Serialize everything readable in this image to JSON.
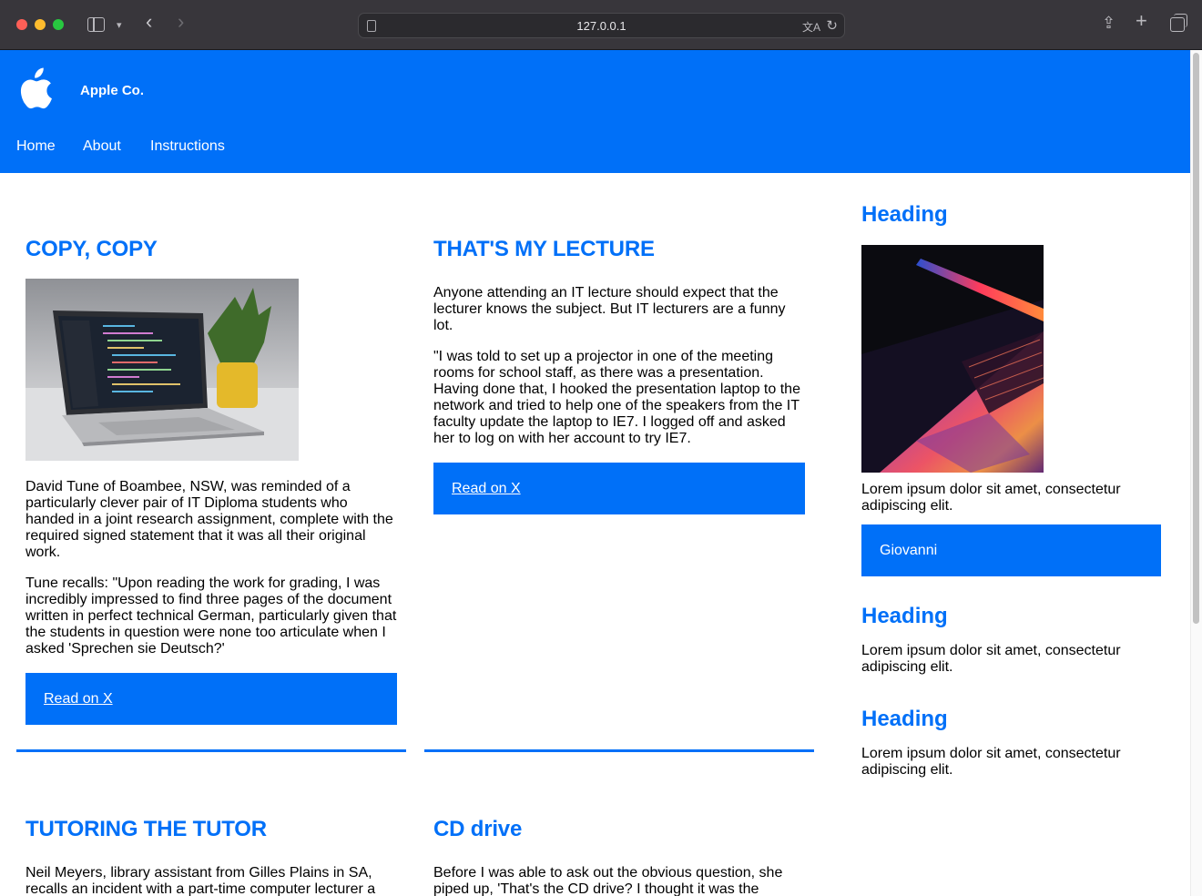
{
  "browser": {
    "url": "127.0.0.1"
  },
  "site": {
    "brand": "Apple Co.",
    "nav": [
      {
        "label": "Home"
      },
      {
        "label": "About"
      },
      {
        "label": "Instructions"
      }
    ]
  },
  "articles": [
    {
      "title": "COPY, COPY",
      "paragraphs": [
        "David Tune of Boambee, NSW, was reminded of a particularly clever pair of IT Diploma students who handed in a joint research assignment, complete with the required signed statement that it was all their original work.",
        "Tune recalls: \"Upon reading the work for grading, I was incredibly impressed to find three pages of the document written in perfect technical German, particularly given that the students in question were none too articulate when I asked 'Sprechen sie Deutsch?'"
      ],
      "link": "Read on X"
    },
    {
      "title": "THAT'S MY LECTURE",
      "paragraphs": [
        "Anyone attending an IT lecture should expect that the lecturer knows the subject. But IT lecturers are a funny lot.",
        "\"I was told to set up a projector in one of the meeting rooms for school staff, as there was a presentation. Having done that, I hooked the presentation laptop to the network and tried to help one of the speakers from the IT faculty update the laptop to IE7. I logged off and asked her to log on with her account to try IE7."
      ],
      "link": "Read on X"
    },
    {
      "title": "TUTORING THE TUTOR",
      "paragraphs": [
        "Neil Meyers, library assistant from Gilles Plains in SA, recalls an incident with a part-time computer lecturer a"
      ]
    },
    {
      "title": "CD drive",
      "paragraphs": [
        "Before I was able to ask out the obvious question, she piped up, 'That's the CD drive? I thought it was the"
      ]
    }
  ],
  "sidebar": {
    "blocks": [
      {
        "heading": "Heading",
        "text": "Lorem ipsum dolor sit amet, consectetur adipiscing elit.",
        "button": "Giovanni"
      },
      {
        "heading": "Heading",
        "text": "Lorem ipsum dolor sit amet, consectetur adipiscing elit."
      },
      {
        "heading": "Heading",
        "text": "Lorem ipsum dolor sit amet, consectetur adipiscing elit."
      }
    ]
  },
  "colors": {
    "accent": "#0070f8"
  }
}
